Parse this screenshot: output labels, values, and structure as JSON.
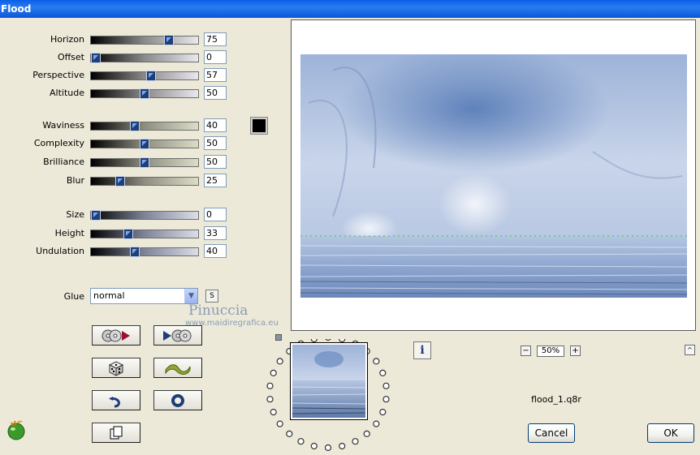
{
  "window": {
    "title": "Flood"
  },
  "sliders_group1": [
    {
      "label": "Horizon",
      "value": "75",
      "pos": 0.75,
      "grad": "gray"
    },
    {
      "label": "Offset",
      "value": "0",
      "pos": 0.0,
      "grad": "gray"
    },
    {
      "label": "Perspective",
      "value": "57",
      "pos": 0.57,
      "grad": "gray"
    },
    {
      "label": "Altitude",
      "value": "50",
      "pos": 0.5,
      "grad": "gray"
    }
  ],
  "sliders_group2": [
    {
      "label": "Waviness",
      "value": "40",
      "pos": 0.4,
      "grad": "sand"
    },
    {
      "label": "Complexity",
      "value": "50",
      "pos": 0.5,
      "grad": "sand"
    },
    {
      "label": "Brilliance",
      "value": "50",
      "pos": 0.5,
      "grad": "sand"
    },
    {
      "label": "Blur",
      "value": "25",
      "pos": 0.25,
      "grad": "sand"
    }
  ],
  "sliders_group3": [
    {
      "label": "Size",
      "value": "0",
      "pos": 0.0,
      "grad": "blue"
    },
    {
      "label": "Height",
      "value": "33",
      "pos": 0.33,
      "grad": "blue"
    },
    {
      "label": "Undulation",
      "value": "40",
      "pos": 0.4,
      "grad": "blue"
    }
  ],
  "glue": {
    "label": "Glue",
    "value": "normal",
    "s_label": "S"
  },
  "watermark": {
    "name": "Pinuccia",
    "url": "www.maidiregrafica.eu"
  },
  "zoom": {
    "minus": "−",
    "value": "50%",
    "plus": "+"
  },
  "info_label": "i",
  "collapse_label": "^",
  "filename": "flood_1.q8r",
  "buttons": {
    "cancel": "Cancel",
    "ok": "OK"
  },
  "colors": {
    "swatch": "#000000",
    "accent": "#0a5fe8"
  },
  "icons": {
    "load": "cd-play-icon",
    "save": "play-cd-icon",
    "random": "dice-icon",
    "wave": "wave-icon",
    "undo": "undo-icon",
    "reset": "ring-icon",
    "copy": "copy-pages-icon"
  }
}
